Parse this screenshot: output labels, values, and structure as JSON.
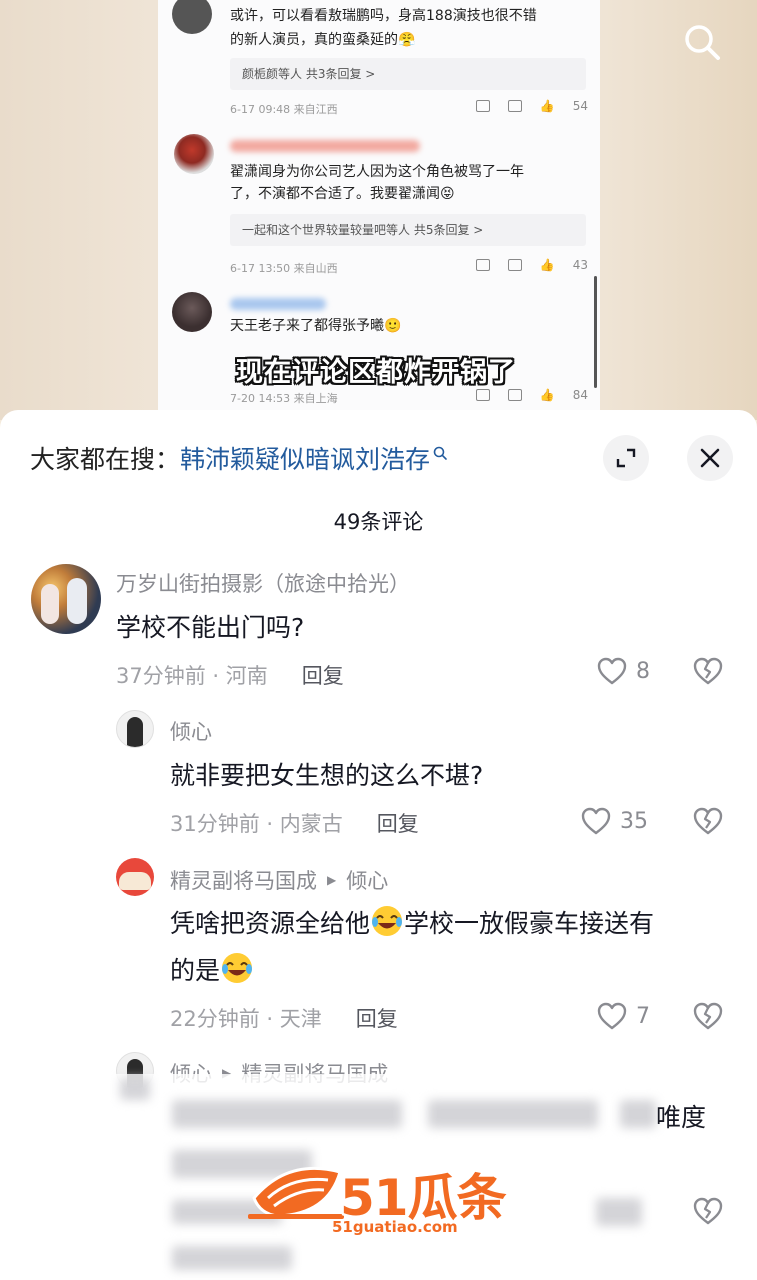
{
  "video_screenshot": {
    "comments": [
      {
        "text_line1": "或许，可以看看敖瑞鹏吗，身高188演技也很不错",
        "text_line2": "的新人演员，真的蛮桑延的😤",
        "reply_summary": "颜栀颜等人 共3条回复 >",
        "time_location": "6-17 09:48 来自江西",
        "likes": "54"
      },
      {
        "text_line1": "翟潇闻身为你公司艺人因为这个角色被骂了一年",
        "text_line2": "了，不演都不合适了。我要翟潇闻😝",
        "reply_summary": "一起和这个世界较量较量吧等人 共5条回复 >",
        "time_location": "6-17 13:50 来自山西",
        "likes": "43"
      },
      {
        "text_line1": "天王老子来了都得张予曦🙂",
        "time_location": "7-20 14:53 来自上海",
        "likes": "84"
      }
    ],
    "subtitle": "现在评论区都炸开锅了"
  },
  "sheet": {
    "hot_search_prefix": "大家都在搜：",
    "hot_search_term": "韩沛颖疑似暗讽刘浩存",
    "comment_count": "49条评论",
    "comments": [
      {
        "name": "万岁山街拍摄影（旅途中拾光）",
        "text": "学校不能出门吗?",
        "meta": "37分钟前 · 河南",
        "reply_label": "回复",
        "likes": "8"
      },
      {
        "name": "倾心",
        "text": "就非要把女生想的这么不堪?",
        "meta": "31分钟前 · 内蒙古",
        "reply_label": "回复",
        "likes": "35"
      },
      {
        "name": "精灵副将马国成",
        "reply_to": "倾心",
        "text_part1": "凭啥把资源全给他",
        "text_part2": "学校一放假豪车接送有",
        "text_part3": "的是",
        "meta": "22分钟前 · 天津",
        "reply_label": "回复",
        "likes": "7"
      },
      {
        "name": "倾心",
        "reply_to": "精灵副将马国成",
        "text_visible_tail": "唯度"
      }
    ]
  },
  "watermark": {
    "brand": "51瓜条",
    "url": "51guatiao.com"
  },
  "colors": {
    "hot_search_term": "#235b9d",
    "watermark": "#f26a22",
    "secondary_text": "#8a8b91"
  }
}
